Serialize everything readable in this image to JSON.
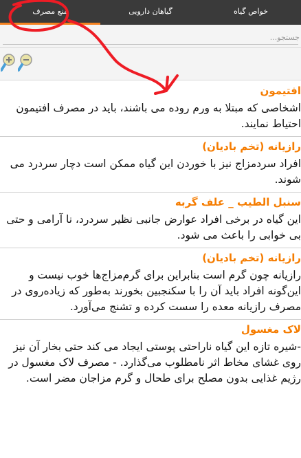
{
  "tabs": [
    {
      "label": "منع مصرف",
      "active": true
    },
    {
      "label": "گیاهان دارویی",
      "active": false
    },
    {
      "label": "خواص گیاه",
      "active": false
    }
  ],
  "search": {
    "placeholder": "جستجو..."
  },
  "toolbar": {
    "zoom_in_icon": "zoom-in-icon",
    "zoom_out_icon": "zoom-out-icon"
  },
  "items": [
    {
      "title": "افتیمون",
      "body": "اشخاصی که مبتلا به ورم روده می باشند، باید در مصرف افتیمون احتیاط نمایند."
    },
    {
      "title": "رازیانه (تخم بادیان)",
      "body": "افراد سردمزاج نیز با خوردن این گیاه ممکن است دچار سردرد می شوند."
    },
    {
      "title": "سنبل الطیب _ علف گربه",
      "body": "این گیاه در برخی افراد عوارض جانبی نظیر سردرد، نا آرامی و حتی بی خوابی را باعث می شود."
    },
    {
      "title": "رازیانه (تخم بادیان)",
      "body": "رازیانه چون گرم است بنابراین برای گرم‌مزاج‌ها خوب نیست و این‌گونه افراد باید آن را با سکنجبین بخورند به‌طور که زیاده‌روی در مصرف رازیانه معده را سست کرده و تشنج می‌آورد."
    },
    {
      "title": "لاک مغسول",
      "body": "-شیره تازه این گیاه ناراحتی پوستی ایجاد می کند حتی بخار آن نیز روی غشای مخاط اثر نامطلوب می‌گذارد. - مصرف لاک مغسول در رژیم غذایی بدون مصلح برای طحال و گرم مزاجان مضر است."
    }
  ],
  "colors": {
    "tabbar": "#3a3a3a",
    "accent": "#f58220",
    "title": "#f57c00",
    "annotation": "#ee1c25"
  }
}
